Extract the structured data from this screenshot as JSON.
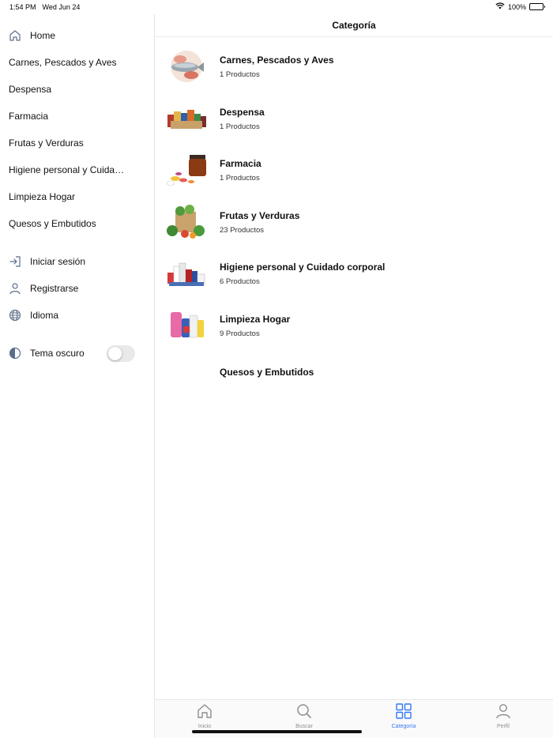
{
  "status_bar": {
    "time": "1:54 PM",
    "date": "Wed Jun 24",
    "battery": "100%"
  },
  "sidebar": {
    "home": "Home",
    "categories": [
      "Carnes, Pescados y Aves",
      "Despensa",
      "Farmacia",
      "Frutas y Verduras",
      "Higiene personal y Cuidado corporal",
      "Limpieza Hogar",
      "Quesos y Embutidos"
    ],
    "login": "Iniciar sesión",
    "register": "Registrarse",
    "language": "Idioma",
    "dark_theme": "Tema oscuro",
    "dark_theme_enabled": false
  },
  "main": {
    "title": "Categoría",
    "categories": [
      {
        "name": "Carnes, Pescados y Aves",
        "count": "1 Productos",
        "thumb": "fish-meat"
      },
      {
        "name": "Despensa",
        "count": "1 Productos",
        "thumb": "pantry-goods"
      },
      {
        "name": "Farmacia",
        "count": "1 Productos",
        "thumb": "pills-bottle"
      },
      {
        "name": "Frutas y Verduras",
        "count": "23 Productos",
        "thumb": "vegetable-bag"
      },
      {
        "name": "Higiene personal y Cuidado corporal",
        "count": "6 Productos",
        "thumb": "hygiene-products"
      },
      {
        "name": "Limpieza Hogar",
        "count": "9 Productos",
        "thumb": "cleaning-products"
      },
      {
        "name": "Quesos y Embutidos",
        "count": "",
        "thumb": ""
      }
    ]
  },
  "tabbar": {
    "tabs": [
      {
        "label": "Inicio",
        "icon": "home-icon"
      },
      {
        "label": "Buscar",
        "icon": "search-icon"
      },
      {
        "label": "Categoría",
        "icon": "grid-icon",
        "active": true
      },
      {
        "label": "Perfil",
        "icon": "person-icon"
      }
    ]
  },
  "colors": {
    "accent": "#3478f6",
    "icon_gray": "#8e8e93",
    "sidebar_icon": "#5b6e8a"
  }
}
